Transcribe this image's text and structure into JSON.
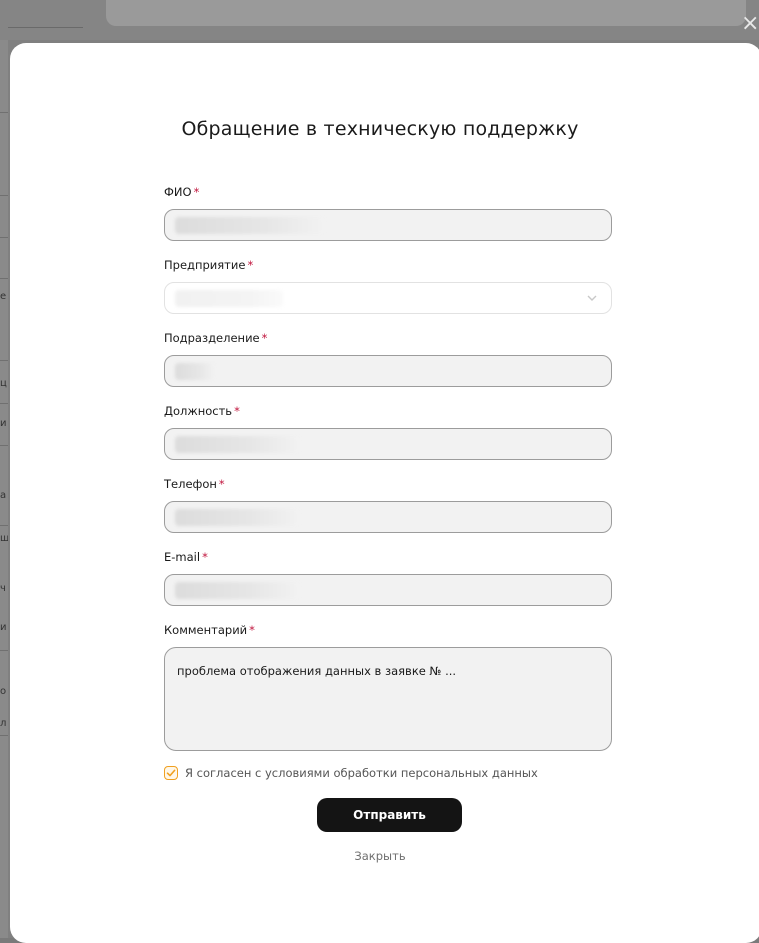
{
  "background": {
    "row_glyphs": [
      "е",
      "ц",
      "и",
      "а",
      "ш",
      "ч",
      "й",
      "о",
      "л"
    ]
  },
  "modal": {
    "title": "Обращение в техническую поддержку",
    "close_icon": "×",
    "fields": [
      {
        "label": "ФИО",
        "required_mark": "*",
        "value": "",
        "type": "text"
      },
      {
        "label": "Предприятие",
        "required_mark": "*",
        "value": "",
        "type": "select"
      },
      {
        "label": "Подразделение",
        "required_mark": "*",
        "value": "",
        "type": "text"
      },
      {
        "label": "Должность",
        "required_mark": "*",
        "value": "",
        "type": "text"
      },
      {
        "label": "Телефон",
        "required_mark": "*",
        "value": "",
        "type": "text"
      },
      {
        "label": "E-mail",
        "required_mark": "*",
        "value": "",
        "type": "text"
      }
    ],
    "comment": {
      "label": "Комментарий",
      "required_mark": "*",
      "value": "проблема отображения данных в заявке № ..."
    },
    "consent": {
      "checked": true,
      "label": "Я согласен с условиями обработки персональных данных"
    },
    "submit_label": "Отправить",
    "close_label": "Закрыть"
  },
  "colors": {
    "required": "#c0143c",
    "checkbox_accent": "#f0a020",
    "button_bg": "#141414"
  }
}
